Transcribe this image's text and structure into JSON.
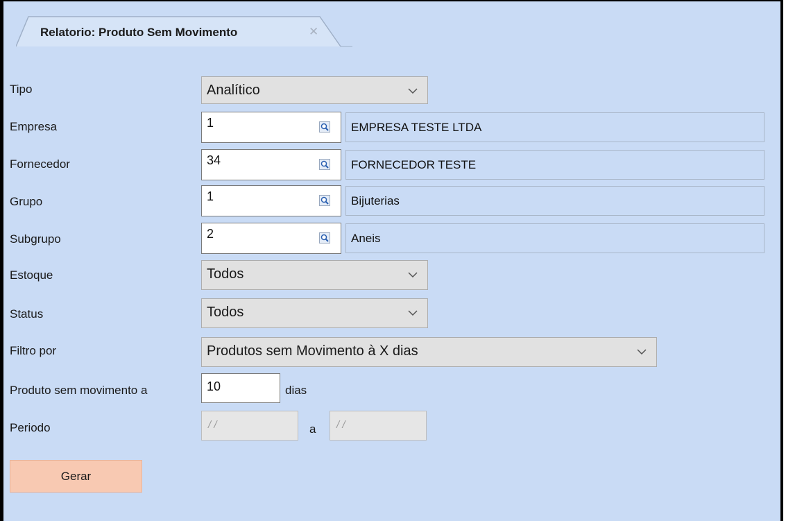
{
  "tab": {
    "title": "Relatorio: Produto Sem Movimento",
    "close_glyph": "✕"
  },
  "form": {
    "tipo": {
      "label": "Tipo",
      "value": "Analítico"
    },
    "empresa": {
      "label": "Empresa",
      "code": "1",
      "description": "EMPRESA TESTE LTDA"
    },
    "fornecedor": {
      "label": "Fornecedor",
      "code": "34",
      "description": "FORNECEDOR TESTE"
    },
    "grupo": {
      "label": "Grupo",
      "code": "1",
      "description": "Bijuterias"
    },
    "subgrupo": {
      "label": "Subgrupo",
      "code": "2",
      "description": "Aneis"
    },
    "estoque": {
      "label": "Estoque",
      "value": "Todos"
    },
    "status": {
      "label": "Status",
      "value": "Todos"
    },
    "filtro": {
      "label": "Filtro por",
      "value": "Produtos sem Movimento à X dias"
    },
    "sem_movimento": {
      "label": "Produto sem movimento a",
      "value": "10",
      "suffix": "dias"
    },
    "periodo": {
      "label": "Periodo",
      "start": "/ /",
      "separator": "a",
      "end": "/ /"
    }
  },
  "actions": {
    "generate_label": "Gerar"
  },
  "colors": {
    "background": "#c9dbf5",
    "button": "#f8c9b2"
  },
  "icons": {
    "lookup": "magnifier-icon",
    "dropdown": "chevron-down-icon"
  }
}
